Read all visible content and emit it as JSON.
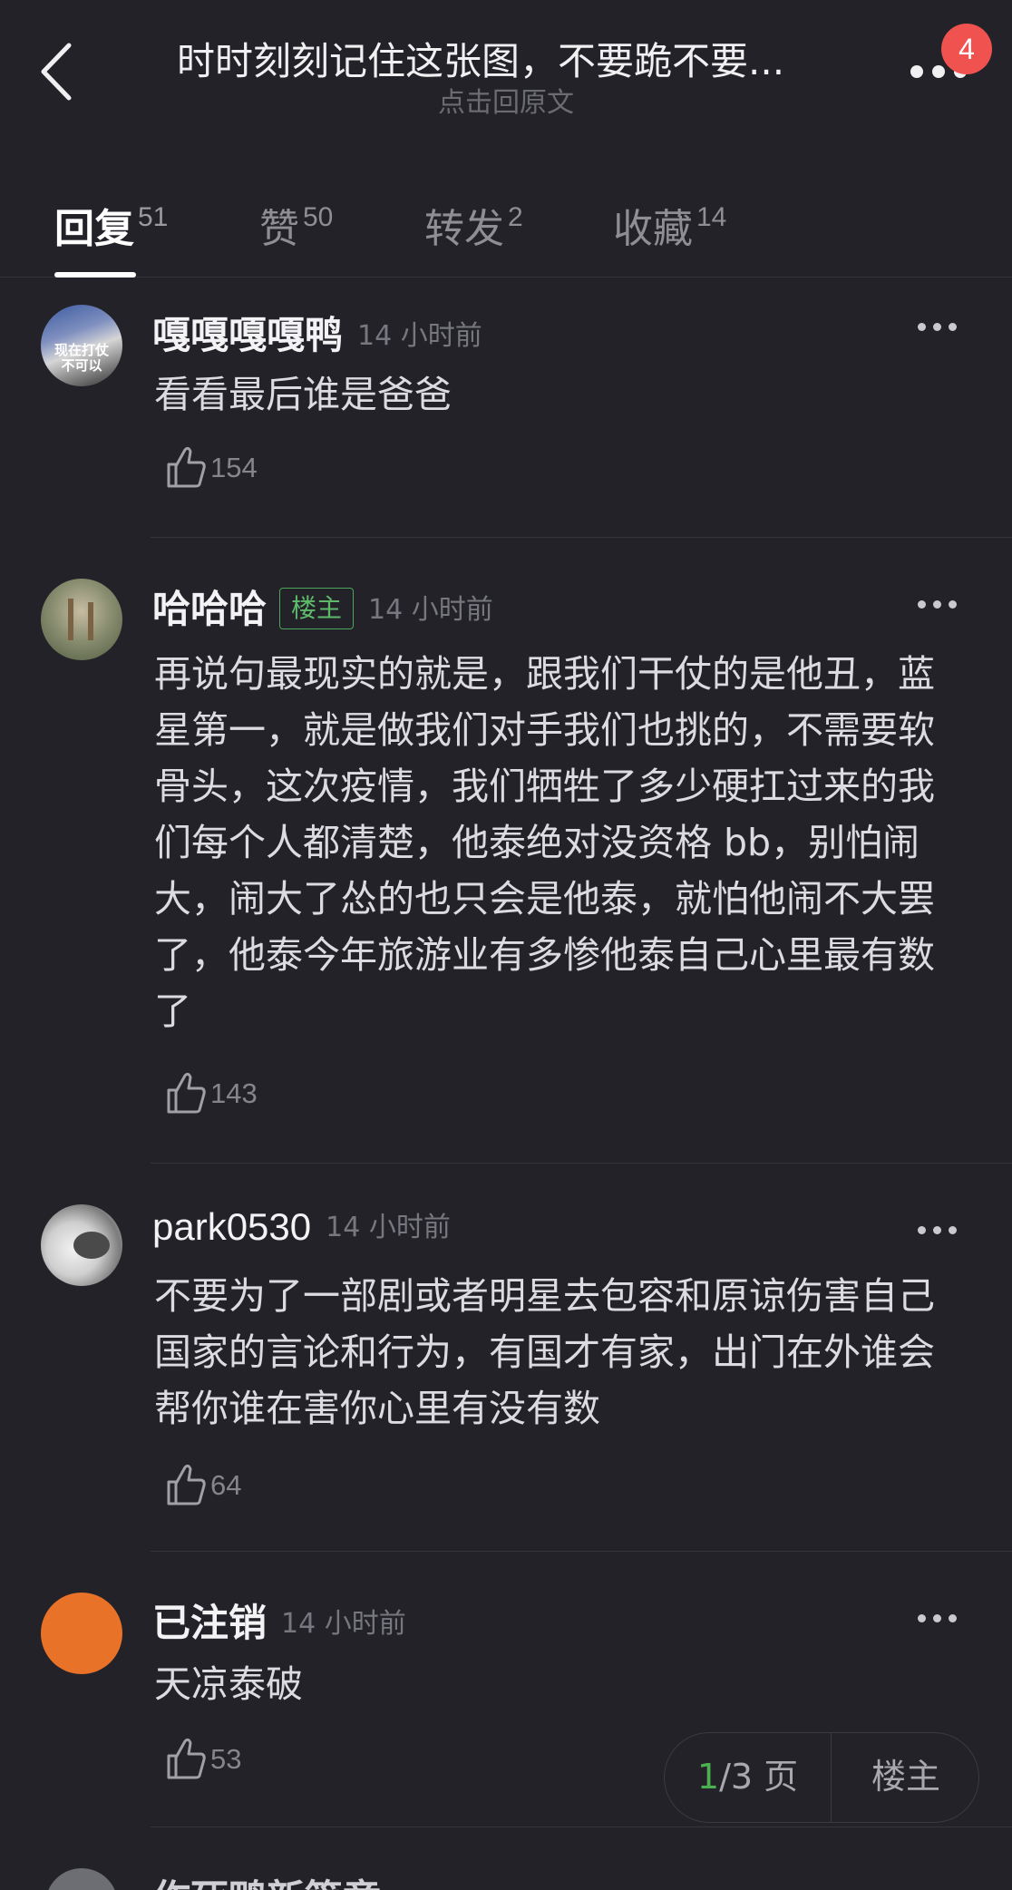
{
  "header": {
    "title": "时时刻刻记住这张图，不要跪不要...",
    "subtitle": "点击回原文",
    "notification_count": "4"
  },
  "tabs": [
    {
      "label": "回复",
      "count": "51"
    },
    {
      "label": "赞",
      "count": "50"
    },
    {
      "label": "转发",
      "count": "2"
    },
    {
      "label": "收藏",
      "count": "14"
    }
  ],
  "comments": [
    {
      "name": "嘎嘎嘎嘎鸭",
      "time": "14 小时前",
      "text": "看看最后谁是爸爸",
      "likes": "154",
      "avatar_text": "现在打仗\n不可以"
    },
    {
      "name": "哈哈哈",
      "badge": "楼主",
      "time": "14 小时前",
      "text": "再说句最现实的就是，跟我们干仗的是他丑，蓝星第一，就是做我们对手我们也挑的，不需要软骨头，这次疫情，我们牺牲了多少硬扛过来的我们每个人都清楚，他泰绝对没资格 bb，别怕闹大，闹大了怂的也只会是他泰，就怕他闹不大罢了，他泰今年旅游业有多惨他泰自己心里最有数了",
      "likes": "143"
    },
    {
      "name": "park0530",
      "time": "14 小时前",
      "text": "不要为了一部剧或者明星去包容和原谅伤害自己国家的言论和行为，有国才有家，出门在外谁会帮你谁在害你心里有没有数",
      "likes": "64"
    },
    {
      "name": "已注销",
      "time": "14 小时前",
      "text": "天凉泰破",
      "likes": "53"
    }
  ],
  "partial_name": "作死鸭新篇章",
  "pager": {
    "current": "1",
    "total_label": "/3 页",
    "op_label": "楼主"
  },
  "colors": {
    "background": "#222228",
    "accent_green": "#4caf50",
    "badge_red": "#f0524f",
    "orange_avatar": "#e87228"
  }
}
